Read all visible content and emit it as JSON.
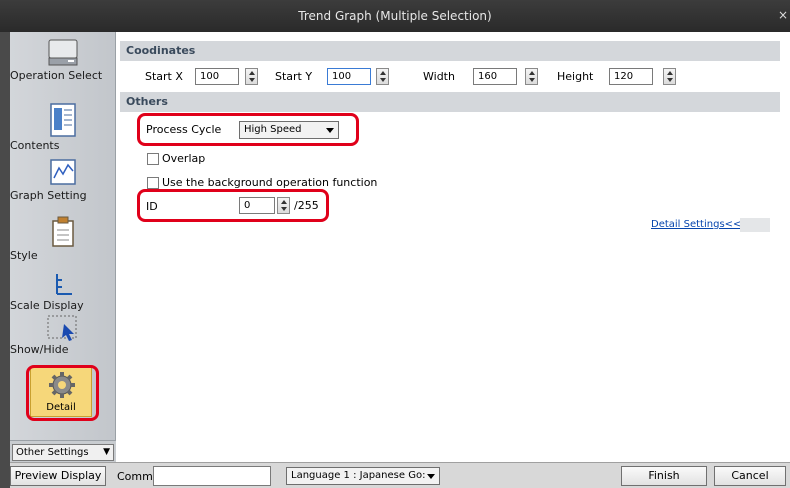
{
  "window": {
    "title": "Trend Graph (Multiple Selection)",
    "close_glyph": "×"
  },
  "sidebar": {
    "items": [
      {
        "label": "Operation Select",
        "icon": "operation-select-icon"
      },
      {
        "label": "Contents",
        "icon": "contents-icon"
      },
      {
        "label": "Graph Setting",
        "icon": "graph-setting-icon"
      },
      {
        "label": "Style",
        "icon": "style-icon"
      },
      {
        "label": "Scale Display",
        "icon": "scale-display-icon"
      },
      {
        "label": "Show/Hide",
        "icon": "show-hide-icon"
      },
      {
        "label": "Detail",
        "icon": "gear-icon",
        "selected": true
      }
    ],
    "other_settings": "Other Settings"
  },
  "coordinates": {
    "header": "Coodinates",
    "start_x_label": "Start X",
    "start_x": "100",
    "start_y_label": "Start Y",
    "start_y": "100",
    "width_label": "Width",
    "width": "160",
    "height_label": "Height",
    "height": "120"
  },
  "others": {
    "header": "Others",
    "process_cycle_label": "Process Cycle",
    "process_cycle_value": "High Speed",
    "overlap_label": "Overlap",
    "overlap_checked": false,
    "background_label": "Use the background operation function",
    "background_checked": false,
    "id_label": "ID",
    "id_value": "0",
    "id_max": "/255",
    "detail_settings_link": "Detail Settings<<"
  },
  "bottom": {
    "preview_display": "Preview Display",
    "comm_label": "Comm",
    "comm_value": "",
    "language": "Language 1 : Japanese Go:",
    "finish": "Finish",
    "cancel": "Cancel"
  },
  "colors": {
    "highlight": "#e0001a",
    "selected_item": "#f6d77a",
    "header_band": "#d4d7db"
  }
}
